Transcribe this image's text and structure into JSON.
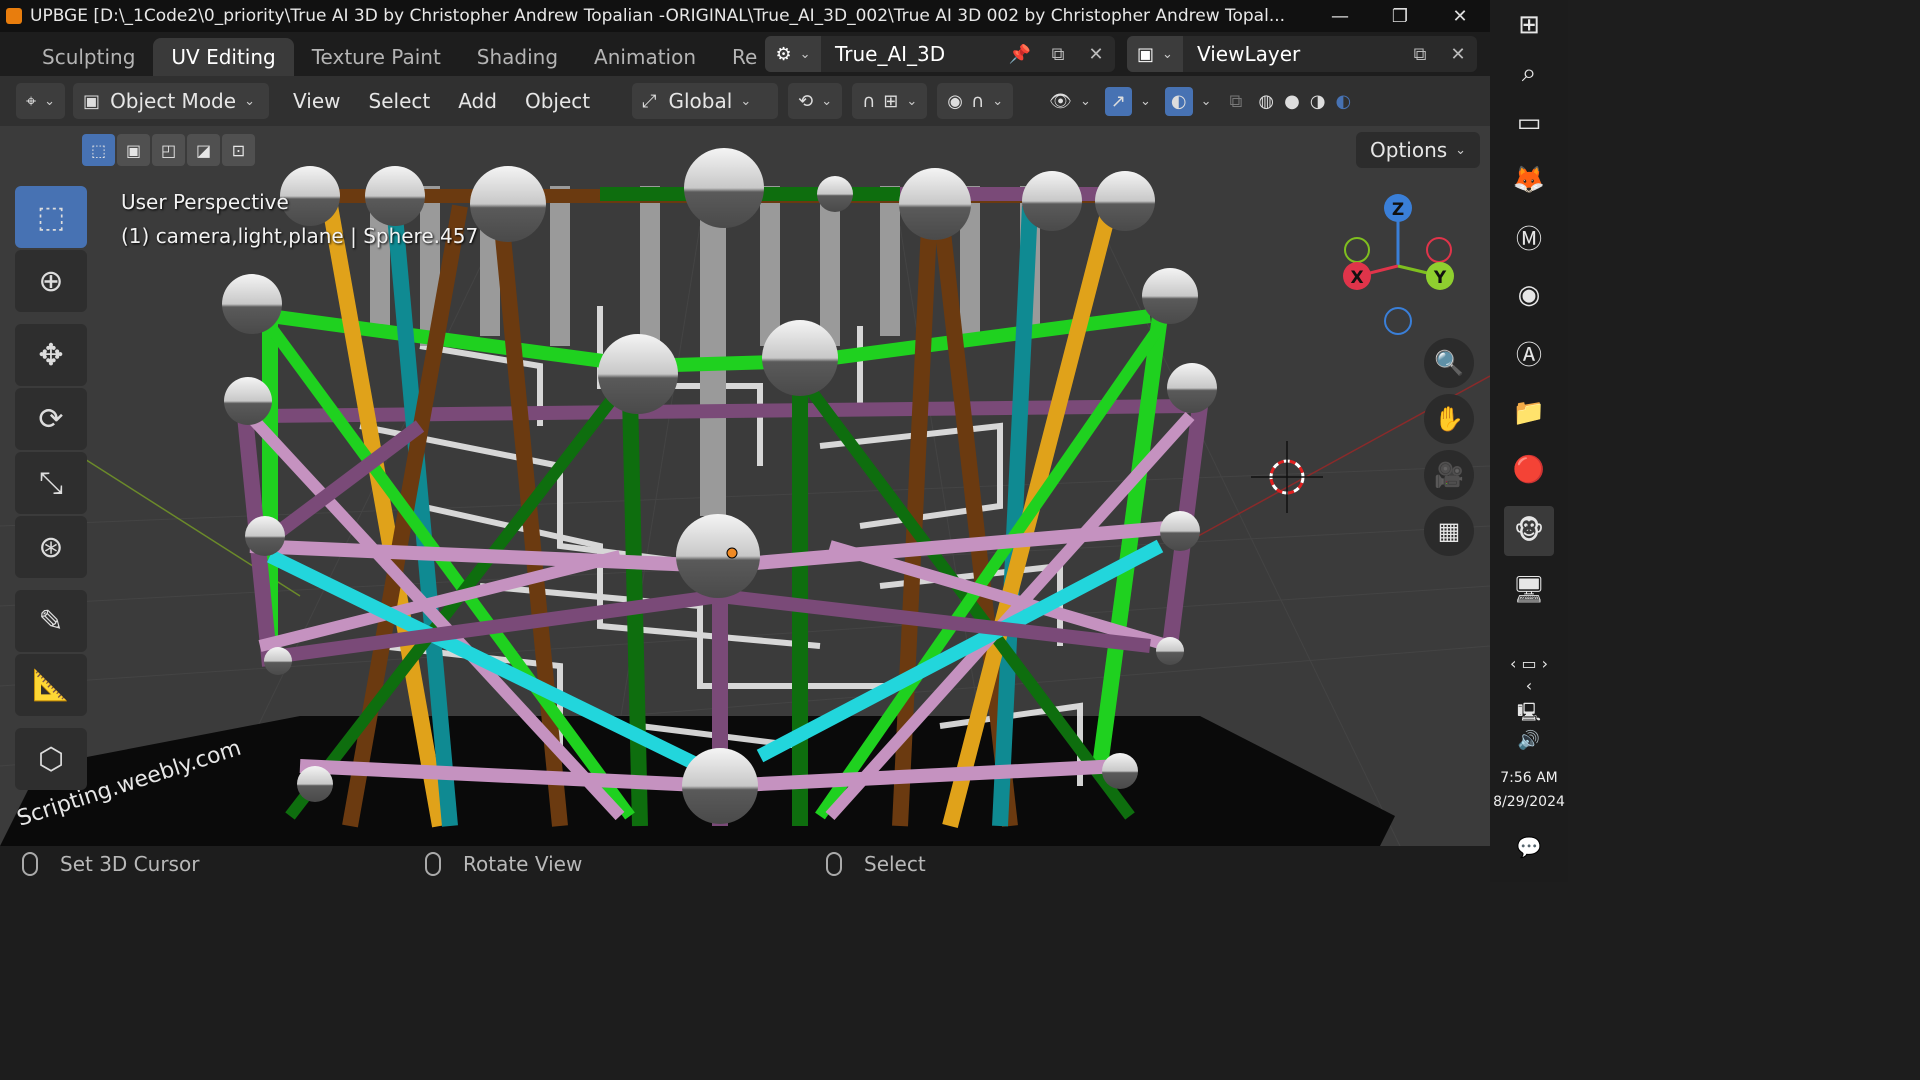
{
  "window": {
    "title": "UPBGE [D:\\_1Code2\\0_priority\\True AI 3D by Christopher Andrew Topalian -ORIGINAL\\True_AI_3D_002\\True AI 3D 002 by Christopher Andrew Topal..."
  },
  "workspace_tabs": [
    "Sculpting",
    "UV Editing",
    "Texture Paint",
    "Shading",
    "Animation",
    "Re"
  ],
  "active_tab": "UV Editing",
  "scene": {
    "name": "True_AI_3D"
  },
  "view_layer": {
    "name": "ViewLayer"
  },
  "header": {
    "mode": "Object Mode",
    "menus": [
      "View",
      "Select",
      "Add",
      "Object"
    ],
    "transform_orientation": "Global"
  },
  "viewport": {
    "options_label": "Options",
    "perspective_label": "User Perspective",
    "object_label": "(1) camera,light,plane | Sphere.457",
    "gizmo": {
      "z": "Z",
      "x": "X",
      "y": "Y"
    },
    "floor_text": "Scripting.weebly.com"
  },
  "colors": {
    "accent": "#4772b3",
    "beam_green": "#1fd11f",
    "beam_darkgreen": "#0e6e0e",
    "beam_brown": "#6b3a10",
    "beam_orange": "#e0a21a",
    "beam_teal": "#0f8a92",
    "beam_cyan": "#22d6dc",
    "beam_pink": "#c592c0",
    "beam_purple": "#7a4a78"
  },
  "toolbar_tools": [
    {
      "name": "select-box-tool",
      "icon": "select-box-icon"
    },
    {
      "name": "cursor-tool",
      "icon": "cursor-icon"
    },
    {
      "name": "move-tool",
      "icon": "move-icon"
    },
    {
      "name": "rotate-tool",
      "icon": "rotate-icon"
    },
    {
      "name": "scale-tool",
      "icon": "scale-icon"
    },
    {
      "name": "transform-tool",
      "icon": "transform-icon"
    },
    {
      "name": "annotate-tool",
      "icon": "annotate-icon"
    },
    {
      "name": "measure-tool",
      "icon": "measure-icon"
    },
    {
      "name": "add-cube-tool",
      "icon": "add-cube-icon"
    }
  ],
  "status_bar": {
    "left": "Set 3D Cursor",
    "middle": "Rotate View",
    "right": "Select"
  },
  "taskbar": {
    "time": "7:56 AM",
    "date": "8/29/2024"
  }
}
